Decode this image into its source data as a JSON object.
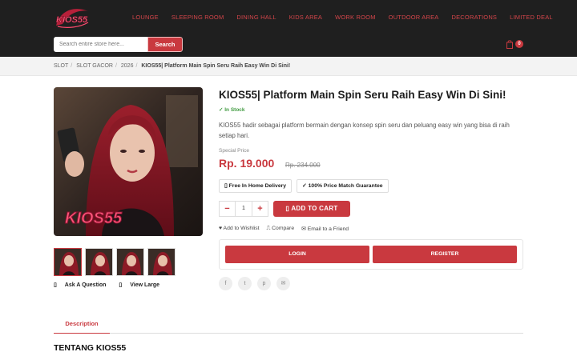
{
  "header": {
    "logo_text": "KIOS55",
    "nav": [
      "LOUNGE",
      "SLEEPING ROOM",
      "DINING HALL",
      "KIDS AREA",
      "WORK ROOM",
      "OUTDOOR AREA",
      "DECORATIONS",
      "LIMITED DEAL"
    ],
    "search": {
      "placeholder": "Search entire store here...",
      "button_label": "Search"
    },
    "cart_count": "0"
  },
  "breadcrumb": {
    "items": [
      "SLOT",
      "SLOT GACOR",
      "2026"
    ],
    "current": "KIOS55| Platform Main Spin Seru Raih Easy Win Di Sini!"
  },
  "product": {
    "title": "KIOS55| Platform Main Spin Seru Raih Easy Win Di Sini!",
    "stock": "✓ In Stock",
    "description": "KIOS55 hadir sebagai platform bermain dengan konsep spin seru dan peluang easy win yang bisa di raih setiap hari.",
    "special_price_label": "Special Price",
    "price": "Rp. 19.000",
    "old_price": "Rp. 234.000",
    "badges": [
      "Free In Home Delivery",
      "✓ 100% Price Match Guarantee"
    ],
    "quantity": "1",
    "add_to_cart": "ADD TO CART",
    "actions": [
      "♥ Add to Wishlist",
      "⎍ Compare",
      "✉ Email to a Friend"
    ],
    "login_label": "LOGIN",
    "register_label": "REGISTER",
    "image_links": [
      "Ask A Question",
      "View Large"
    ]
  },
  "tabs": {
    "active": "Description"
  },
  "section_title": "TENTANG KIOS55",
  "colors": {
    "accent": "#c9393f",
    "header_bg": "#1f1f1f",
    "stock": "#3f9a3f"
  }
}
